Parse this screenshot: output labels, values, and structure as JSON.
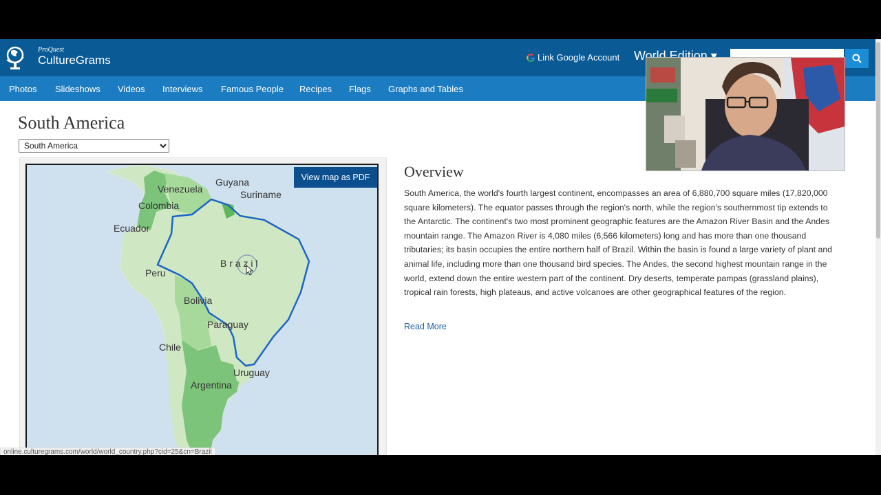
{
  "header": {
    "logo_small": "ProQuest",
    "logo_big": "CultureGrams",
    "google_link": "Link Google Account",
    "edition": "World Edition",
    "search_placeholder": "",
    "search_icon": "search-icon"
  },
  "nav": {
    "items": [
      "Photos",
      "Slideshows",
      "Videos",
      "Interviews",
      "Famous People",
      "Recipes",
      "Flags",
      "Graphs and Tables"
    ]
  },
  "page": {
    "title": "South America",
    "region_select": {
      "selected": "South America"
    }
  },
  "map": {
    "pdf_button": "View map as PDF",
    "labels": {
      "venezuela": "Venezuela",
      "guyana": "Guyana",
      "suriname": "Suriname",
      "colombia": "Colombia",
      "ecuador": "Ecuador",
      "peru": "Peru",
      "brazil": "B r a z i l",
      "bolivia": "Bolivia",
      "paraguay": "Paraguay",
      "chile": "Chile",
      "uruguay": "Uruguay",
      "argentina": "Argentina"
    },
    "colors": {
      "ocean": "#cfe0ee",
      "light_land": "#cfe8c3",
      "dark_land": "#7cc47a",
      "mid_land": "#a7d99b",
      "highlight": "#1c64c8"
    }
  },
  "overview": {
    "title": "Overview",
    "text": "South America, the world's fourth largest continent, encompasses an area of 6,880,700 square miles (17,820,000 square kilometers). The equator passes through the region's north, while the region's southernmost tip extends to the Antarctic. The continent's two most prominent geographic features are the Amazon River Basin and the Andes mountain range. The Amazon River is 4,080 miles (6,566 kilometers) long and has more than one thousand tributaries; its basin occupies the entire northern half of Brazil. Within the basin is found a large variety of plant and animal life, including more than one thousand bird species. The Andes, the second highest mountain range in the world, extend down the entire western part of the continent. Dry deserts, temperate pampas (grassland plains), tropical rain forests, high plateaus, and active volcanoes are other geographical features of the region.",
    "read_more": "Read More"
  },
  "status_bar": {
    "url": "online.culturegrams.com/world/world_country.php?cid=25&cn=Brazil"
  }
}
